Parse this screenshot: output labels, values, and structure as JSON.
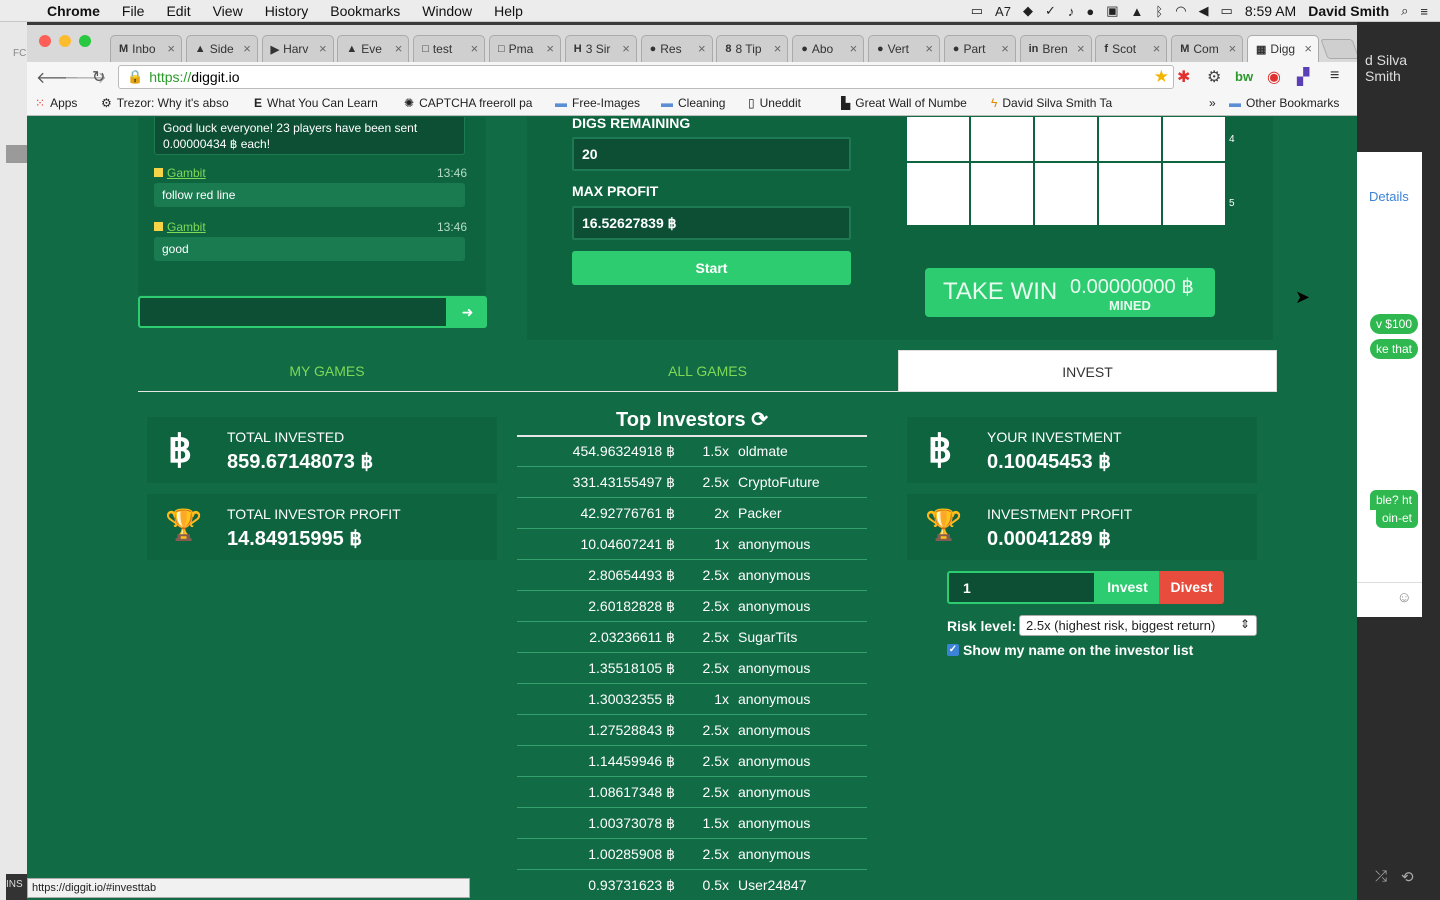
{
  "menubar": {
    "app": "Chrome",
    "items": [
      "File",
      "Edit",
      "View",
      "History",
      "Bookmarks",
      "Window",
      "Help"
    ],
    "status_count": "7",
    "clock": "8:59 AM",
    "user": "David Smith"
  },
  "tabs": [
    {
      "favicon": "M",
      "title": "Inbo"
    },
    {
      "favicon": "▲",
      "title": "Side"
    },
    {
      "favicon": "▶",
      "title": "Harv"
    },
    {
      "favicon": "▲",
      "title": "Eve"
    },
    {
      "favicon": "□",
      "title": "test"
    },
    {
      "favicon": "□",
      "title": "Pma"
    },
    {
      "favicon": "H",
      "title": "3 Sir"
    },
    {
      "favicon": "●",
      "title": "Res"
    },
    {
      "favicon": "8",
      "title": "8 Tip"
    },
    {
      "favicon": "●",
      "title": "Abo"
    },
    {
      "favicon": "●",
      "title": "Vert"
    },
    {
      "favicon": "●",
      "title": "Part"
    },
    {
      "favicon": "in",
      "title": "Bren"
    },
    {
      "favicon": "f",
      "title": "Scot"
    },
    {
      "favicon": "M",
      "title": "Com"
    },
    {
      "favicon": "▦",
      "title": "Digg"
    }
  ],
  "address": {
    "scheme": "https://",
    "host": "diggit.io"
  },
  "bookmarks": {
    "apps": "Apps",
    "items": [
      "Trezor: Why it's abso",
      "What You Can Learn",
      "CAPTCHA freeroll pa",
      "Free-Images",
      "Cleaning",
      "Uneddit",
      "Great Wall of Numbe",
      "David Silva Smith Ta"
    ],
    "more": "»",
    "other": "Other Bookmarks"
  },
  "chat": {
    "announce": "Good luck everyone! 23 players have been sent 0.00000434 ฿ each!",
    "messages": [
      {
        "user": "Gambit",
        "time": "13:46",
        "text": "follow red line"
      },
      {
        "user": "Gambit",
        "time": "13:46",
        "text": "good"
      }
    ],
    "send_icon": "arrow-right-icon"
  },
  "game": {
    "digs_label": "DIGS REMAINING",
    "digs_value": "20",
    "max_profit_label": "MAX PROFIT",
    "max_profit_value": "16.52627839 ฿",
    "start_label": "Start",
    "row_numbers": [
      "4",
      "5"
    ],
    "take_win_label": "TAKE WIN",
    "take_win_amount": "0.00000000 ฿",
    "mined_label": "MINED"
  },
  "section_tabs": [
    {
      "label": "MY GAMES"
    },
    {
      "label": "ALL GAMES"
    },
    {
      "label": "INVEST"
    }
  ],
  "stats": {
    "total_invested_label": "TOTAL INVESTED",
    "total_invested_value": "859.67148073 ฿",
    "total_profit_label": "TOTAL INVESTOR PROFIT",
    "total_profit_value": "14.84915995 ฿",
    "your_investment_label": "YOUR INVESTMENT",
    "your_investment_value": "0.10045453 ฿",
    "investment_profit_label": "INVESTMENT PROFIT",
    "investment_profit_value": "0.00041289 ฿",
    "btc_symbol": "฿",
    "trophy_symbol": "🏆"
  },
  "top_investors": {
    "title": "Top Investors",
    "refresh_icon": "refresh-icon",
    "rows": [
      {
        "amount": "454.96324918 ฿",
        "mult": "1.5x",
        "name": "oldmate"
      },
      {
        "amount": "331.43155497 ฿",
        "mult": "2.5x",
        "name": "CryptoFuture"
      },
      {
        "amount": "42.92776761 ฿",
        "mult": "2x",
        "name": "Packer"
      },
      {
        "amount": "10.04607241 ฿",
        "mult": "1x",
        "name": "anonymous"
      },
      {
        "amount": "2.80654493 ฿",
        "mult": "2.5x",
        "name": "anonymous"
      },
      {
        "amount": "2.60182828 ฿",
        "mult": "2.5x",
        "name": "anonymous"
      },
      {
        "amount": "2.03236611 ฿",
        "mult": "2.5x",
        "name": "SugarTits"
      },
      {
        "amount": "1.35518105 ฿",
        "mult": "2.5x",
        "name": "anonymous"
      },
      {
        "amount": "1.30032355 ฿",
        "mult": "1x",
        "name": "anonymous"
      },
      {
        "amount": "1.27528843 ฿",
        "mult": "2.5x",
        "name": "anonymous"
      },
      {
        "amount": "1.14459946 ฿",
        "mult": "2.5x",
        "name": "anonymous"
      },
      {
        "amount": "1.08617348 ฿",
        "mult": "2.5x",
        "name": "anonymous"
      },
      {
        "amount": "1.00373078 ฿",
        "mult": "1.5x",
        "name": "anonymous"
      },
      {
        "amount": "1.00285908 ฿",
        "mult": "2.5x",
        "name": "anonymous"
      },
      {
        "amount": "0.93731623 ฿",
        "mult": "0.5x",
        "name": "User24847"
      }
    ]
  },
  "invest_form": {
    "amount": "1",
    "invest_label": "Invest",
    "divest_label": "Divest",
    "risk_label": "Risk level:",
    "risk_selected": "2.5x (highest risk, biggest return)",
    "show_name_label": "Show my name on the investor list"
  },
  "statusbar": "https://diggit.io/#investtab",
  "behind_app": {
    "name": "d Silva Smith",
    "details": "Details",
    "bubbles": [
      "v $100",
      "ke that",
      "ble? ht",
      "oin-et"
    ],
    "left_label": "FC",
    "ins_label": "INS"
  }
}
